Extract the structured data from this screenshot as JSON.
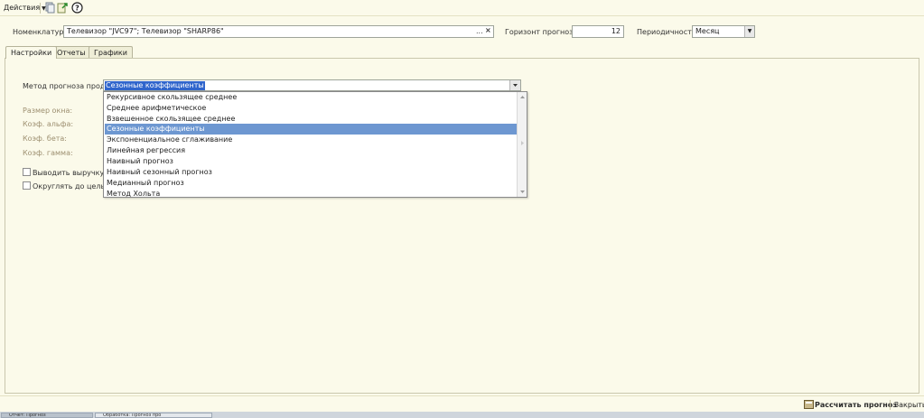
{
  "toolbar": {
    "actions_label": "Действия",
    "icons": [
      "copy-icon",
      "export-icon",
      "help-icon"
    ]
  },
  "header": {
    "nomenclature_label": "Номенклатура:",
    "nomenclature_value": "Телевизор \"JVC97\"; Телевизор \"SHARP86\"",
    "select_button": "...",
    "clear_button": "×",
    "horizon_label": "Горизонт прогноза:",
    "horizon_value": "12",
    "periodicity_label": "Периодичность:",
    "periodicity_value": "Месяц"
  },
  "tabs": [
    {
      "label": "Настройки",
      "active": true
    },
    {
      "label": "Отчеты",
      "active": false
    },
    {
      "label": "Графики",
      "active": false
    }
  ],
  "settings": {
    "method_label": "Метод прогноза продаж:",
    "method_value": "Сезонные коэффициенты",
    "window_size_label": "Размер окна:",
    "alpha_label": "Коэф. альфа:",
    "beta_label": "Коэф. бета:",
    "gamma_label": "Коэф. гамма:",
    "revenue_checkbox_label": "Выводить выручку на г",
    "round_checkbox_label": "Округлять до целых"
  },
  "dropdown": {
    "options": [
      "Рекурсивное скользящее среднее",
      "Среднее арифметическое",
      "Взвешенное скользящее среднее",
      "Сезонные коэффициенты",
      "Экспоненциальное сглаживание",
      "Линейная регрессия",
      "Наивный прогноз",
      "Наивный сезонный прогноз",
      "Медианный прогноз",
      "Метод Хольта"
    ],
    "selected_index": 3
  },
  "footer": {
    "calculate_label": "Рассчитать прогноз",
    "close_label": "Закрыть"
  },
  "taskbar": {
    "items": [
      "Отчет: Прогноз",
      "Обработка: Прогноз про"
    ]
  },
  "colors": {
    "background": "#fbfaea",
    "selection": "#3065cc",
    "list_highlight": "#6d97d1"
  }
}
